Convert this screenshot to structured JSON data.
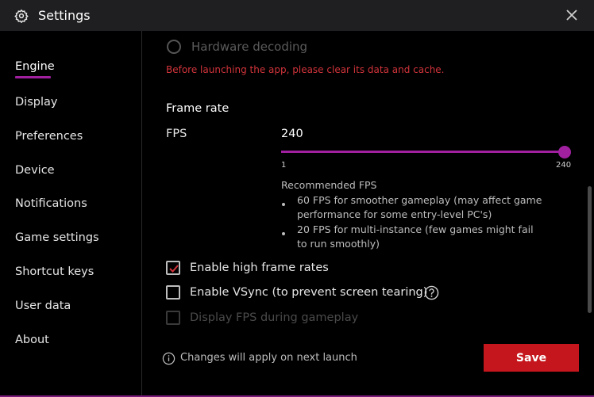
{
  "window": {
    "title": "Settings"
  },
  "sidebar": {
    "items": [
      {
        "label": "Engine",
        "active": true
      },
      {
        "label": "Display"
      },
      {
        "label": "Preferences"
      },
      {
        "label": "Device"
      },
      {
        "label": "Notifications"
      },
      {
        "label": "Game settings"
      },
      {
        "label": "Shortcut keys"
      },
      {
        "label": "User data"
      },
      {
        "label": "About"
      }
    ]
  },
  "engine": {
    "hardware_decoding": {
      "label": "Hardware decoding",
      "selected": false,
      "disabled": true
    },
    "warning": "Before launching the app, please clear its data and cache.",
    "frame_rate": {
      "title": "Frame rate",
      "fps_label": "FPS",
      "fps_value": "240",
      "slider": {
        "min": 1,
        "max": 240,
        "value": 240,
        "min_label": "1",
        "max_label": "240"
      },
      "recommended_title": "Recommended FPS",
      "recommendations": [
        "60 FPS for smoother gameplay (may affect game performance for some entry-level PC's)",
        "20 FPS for multi-instance (few games might fail to run smoothly)"
      ]
    },
    "options": [
      {
        "label": "Enable high frame rates",
        "checked": true,
        "disabled": false
      },
      {
        "label": "Enable VSync (to prevent screen tearing)",
        "checked": false,
        "disabled": false
      },
      {
        "label": "Display FPS during gameplay",
        "checked": false,
        "disabled": true
      }
    ]
  },
  "footer": {
    "note": "Changes will apply on next launch",
    "save_label": "Save"
  },
  "colors": {
    "accent": "#a020a0",
    "save": "#c4161c",
    "warning": "#d1343b",
    "background": "#000000",
    "titlebar": "#1f1f21"
  },
  "icons": {
    "settings": "gear-icon",
    "close": "close-icon",
    "help": "help-icon",
    "info": "info-icon",
    "check": "check-icon"
  }
}
